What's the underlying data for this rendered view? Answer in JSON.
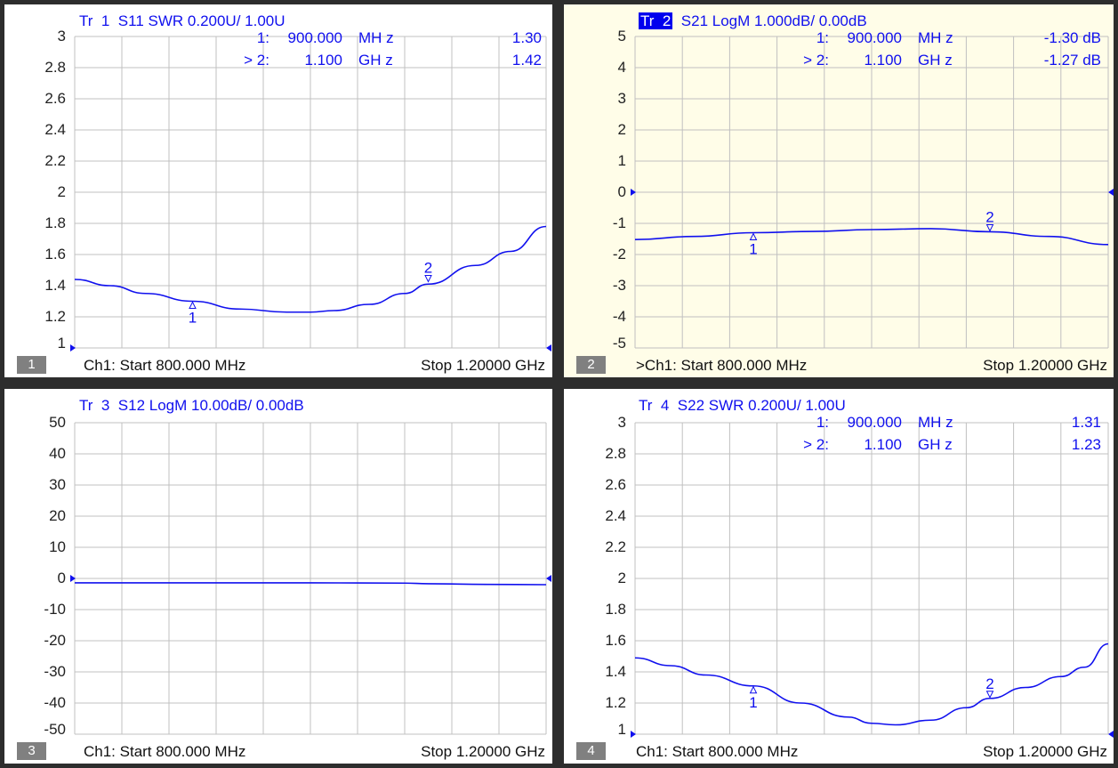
{
  "colors": {
    "trace": "#1010ee",
    "grid": "#c0c0c0",
    "active_bg": "#fffde8",
    "panel_bg": "#ffffff",
    "frame": "#2d2d2d"
  },
  "chart_data": [
    {
      "type": "line",
      "panel": "1",
      "trace_num": "1",
      "title_prefix": "Tr",
      "title": "S11 SWR 0.200U/ 1.00U",
      "xlim": [
        800,
        1200
      ],
      "ylim": [
        1,
        3
      ],
      "yticks": [
        "3",
        "2.8",
        "2.6",
        "2.4",
        "2.2",
        "2",
        "1.8",
        "1.6",
        "1.4",
        "1.2",
        "1"
      ],
      "x": [
        800,
        830,
        860,
        900,
        940,
        980,
        1000,
        1020,
        1050,
        1080,
        1100,
        1140,
        1170,
        1200
      ],
      "y": [
        1.44,
        1.4,
        1.35,
        1.3,
        1.25,
        1.23,
        1.23,
        1.24,
        1.28,
        1.35,
        1.41,
        1.53,
        1.62,
        1.78
      ],
      "markers": [
        {
          "id": "1",
          "row_id": "1:",
          "freq": "900.000",
          "unit": "MH z",
          "value": "1.30",
          "x": 900,
          "y": 1.3
        },
        {
          "id": "2",
          "row_id": "> 2:",
          "freq": "1.100",
          "unit": "GH z",
          "value": "1.42",
          "x": 1100,
          "y": 1.42
        }
      ],
      "footer_left": "Ch1: Start 800.000 MHz",
      "footer_right": "Stop 1.20000 GHz"
    },
    {
      "type": "line",
      "panel": "2",
      "trace_num": "2",
      "title_prefix": "Tr",
      "title": "S21 LogM 1.000dB/ 0.00dB",
      "xlim": [
        800,
        1200
      ],
      "ylim": [
        -5,
        5
      ],
      "yticks": [
        "5",
        "4",
        "3",
        "2",
        "1",
        "0",
        "-1",
        "-2",
        "-3",
        "-4",
        "-5"
      ],
      "x": [
        800,
        850,
        900,
        950,
        1000,
        1050,
        1100,
        1150,
        1200
      ],
      "y": [
        -1.52,
        -1.42,
        -1.3,
        -1.26,
        -1.2,
        -1.17,
        -1.27,
        -1.42,
        -1.68
      ],
      "markers": [
        {
          "id": "1",
          "row_id": "1:",
          "freq": "900.000",
          "unit": "MH z",
          "value": "-1.30 dB",
          "x": 900,
          "y": -1.3
        },
        {
          "id": "2",
          "row_id": "> 2:",
          "freq": "1.100",
          "unit": "GH z",
          "value": "-1.27 dB",
          "x": 1100,
          "y": -1.27
        }
      ],
      "footer_left": ">Ch1: Start 800.000 MHz",
      "footer_right": "Stop 1.20000 GHz"
    },
    {
      "type": "line",
      "panel": "3",
      "trace_num": "3",
      "title_prefix": "Tr",
      "title": "S12 LogM 10.00dB/ 0.00dB",
      "xlim": [
        800,
        1200
      ],
      "ylim": [
        -50,
        50
      ],
      "yticks": [
        "50",
        "40",
        "30",
        "20",
        "10",
        "0",
        "-10",
        "-20",
        "-30",
        "-40",
        "-50"
      ],
      "x": [
        800,
        900,
        1000,
        1080,
        1100,
        1150,
        1200
      ],
      "y": [
        -1.4,
        -1.4,
        -1.4,
        -1.5,
        -1.7,
        -1.9,
        -2.0
      ],
      "markers": [],
      "footer_left": "Ch1: Start 800.000 MHz",
      "footer_right": "Stop 1.20000 GHz"
    },
    {
      "type": "line",
      "panel": "4",
      "trace_num": "4",
      "title_prefix": "Tr",
      "title": "S22 SWR 0.200U/ 1.00U",
      "xlim": [
        800,
        1200
      ],
      "ylim": [
        1,
        3
      ],
      "yticks": [
        "3",
        "2.8",
        "2.6",
        "2.4",
        "2.2",
        "2",
        "1.8",
        "1.6",
        "1.4",
        "1.2",
        "1"
      ],
      "x": [
        800,
        830,
        860,
        900,
        940,
        980,
        1000,
        1020,
        1050,
        1080,
        1100,
        1130,
        1160,
        1180,
        1200
      ],
      "y": [
        1.49,
        1.44,
        1.38,
        1.31,
        1.2,
        1.11,
        1.07,
        1.06,
        1.09,
        1.17,
        1.23,
        1.3,
        1.37,
        1.43,
        1.58
      ],
      "markers": [
        {
          "id": "1",
          "row_id": "1:",
          "freq": "900.000",
          "unit": "MH z",
          "value": "1.31",
          "x": 900,
          "y": 1.31
        },
        {
          "id": "2",
          "row_id": "> 2:",
          "freq": "1.100",
          "unit": "GH z",
          "value": "1.23",
          "x": 1100,
          "y": 1.23
        }
      ],
      "footer_left": "Ch1: Start 800.000 MHz",
      "footer_right": "Stop 1.20000 GHz"
    }
  ]
}
